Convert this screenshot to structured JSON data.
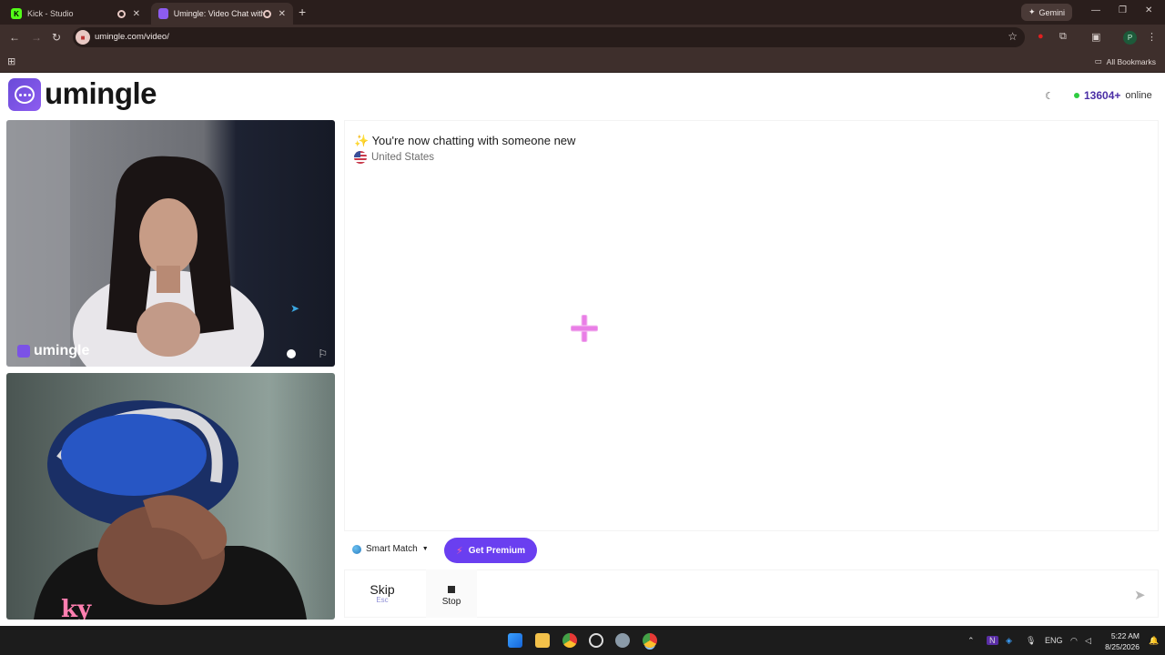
{
  "browser": {
    "tabs": [
      {
        "title": "Kick - Studio",
        "active": false
      },
      {
        "title": "Umingle: Video Chat with S",
        "active": true
      }
    ],
    "gemini_label": "Gemini",
    "url": "umingle.com/video/",
    "bookmarks_label": "All Bookmarks",
    "profile_initial": "P"
  },
  "header": {
    "logo_text": "umingle",
    "online_count": "13604+",
    "online_label": "online"
  },
  "video": {
    "watermark": "umingle"
  },
  "chat": {
    "status_message": "✨ You're now chatting with someone new",
    "country": "United States"
  },
  "controls": {
    "smart_match_label": "Smart Match",
    "premium_label": "Get Premium",
    "skip_label": "Skip",
    "skip_hint": "Esc",
    "stop_label": "Stop",
    "message_placeholder": ""
  },
  "taskbar": {
    "language": "ENG",
    "time": "5:22 AM",
    "date": "8/25/2026"
  },
  "colors": {
    "brand_purple": "#6a3ff0",
    "online_green": "#2ecc40",
    "browser_frame": "#3e2f2c"
  }
}
